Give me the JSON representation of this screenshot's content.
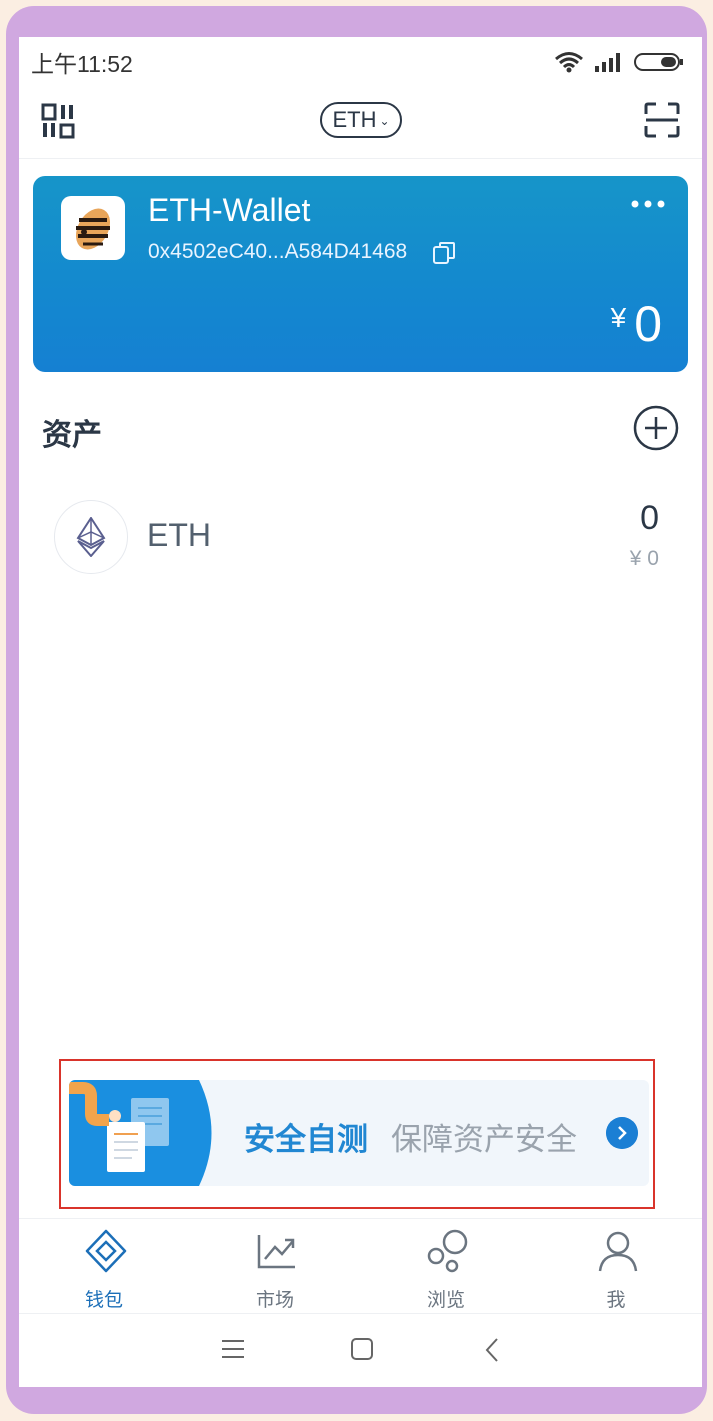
{
  "status_bar": {
    "time": "上午11:52",
    "icons": [
      "wifi-icon",
      "signal-icon",
      "battery-icon"
    ]
  },
  "top_bar": {
    "left_icon": "receive-qr-icon",
    "network_selector": {
      "label": "ETH",
      "icon": "chevron-down-icon"
    },
    "right_icon": "scan-icon"
  },
  "wallet_card": {
    "name": "ETH-Wallet",
    "address": "0x4502eC40...A584D41468",
    "currency_symbol": "¥",
    "balance": "0",
    "gradient": [
      "#1695c9",
      "#1580d2"
    ]
  },
  "assets": {
    "title": "资产",
    "items": [
      {
        "symbol": "ETH",
        "amount": "0",
        "fiat_value": "¥ 0",
        "icon": "ethereum-icon"
      }
    ]
  },
  "banner": {
    "title": "安全自测",
    "subtitle": "保障资产安全",
    "icon": "chevron-right-icon"
  },
  "bottom_nav": {
    "items": [
      {
        "label": "钱包",
        "icon": "wallet-icon",
        "active": true
      },
      {
        "label": "市场",
        "icon": "market-icon",
        "active": false
      },
      {
        "label": "浏览",
        "icon": "browse-icon",
        "active": false
      },
      {
        "label": "我",
        "icon": "profile-icon",
        "active": false
      }
    ]
  },
  "system_nav": {
    "icons": [
      "menu-icon",
      "home-icon",
      "back-icon"
    ]
  },
  "colors": {
    "accent": "#1b7fd4",
    "text_dark": "#2b3746",
    "highlight_outline": "#d9342b"
  }
}
